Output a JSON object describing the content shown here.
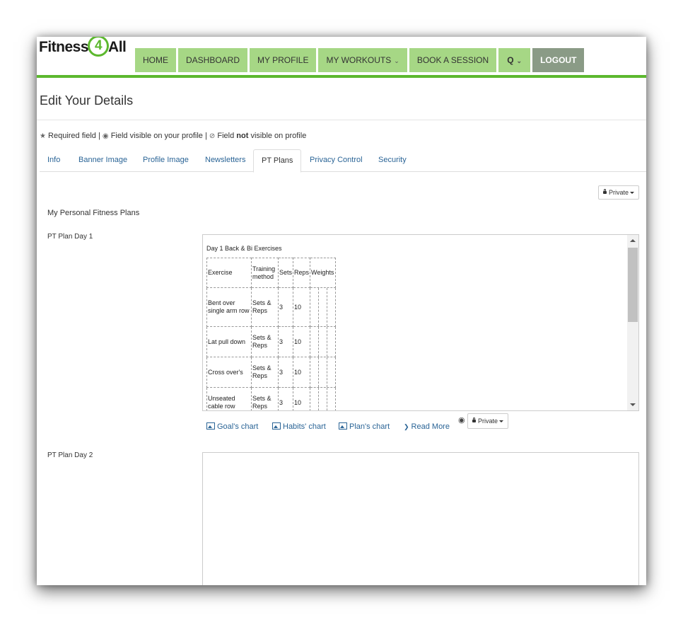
{
  "brand": {
    "logo_pre": "Fitness",
    "logo_num": "4",
    "logo_post": "All",
    "accent_color": "#5cb82e",
    "nav_color": "#a6d785"
  },
  "nav": {
    "items": [
      {
        "label": "HOME"
      },
      {
        "label": "DASHBOARD"
      },
      {
        "label": "MY PROFILE"
      },
      {
        "label": "MY WORKOUTS"
      },
      {
        "label": "BOOK A SESSION"
      },
      {
        "label": "LOGOUT"
      }
    ],
    "workouts_chevron": "⌄",
    "search_icon": "search-icon",
    "search_glyph": "Q",
    "search_chevron": "⌄"
  },
  "page": {
    "title": "Edit Your Details",
    "legend_required": "Required field",
    "legend_sep1": "|",
    "legend_visible": "Field visible on your profile",
    "legend_sep2": "|",
    "legend_field": "Field",
    "legend_not": "not",
    "legend_notvisible": "visible on profile"
  },
  "tabs": [
    {
      "label": "Info"
    },
    {
      "label": "Banner Image"
    },
    {
      "label": "Profile Image"
    },
    {
      "label": "Newsletters"
    },
    {
      "label": "PT Plans",
      "active": true
    },
    {
      "label": "Privacy Control"
    },
    {
      "label": "Security"
    }
  ],
  "privacy": {
    "top_label": "Private",
    "day1_label": "Private"
  },
  "section": {
    "title": "My Personal Fitness Plans",
    "day1_label": "PT Plan Day 1",
    "day2_label": "PT Plan Day 2"
  },
  "plan_day1": {
    "heading": "Day 1 Back & Bi Exercises",
    "headers": [
      "Exercise",
      "Training method",
      "Sets",
      "Reps",
      "Weights"
    ],
    "rows": [
      [
        "Bent over single arm row",
        "Sets & Reps",
        "3",
        "10"
      ],
      [
        "Lat pull down",
        "Sets & Reps",
        "3",
        "10"
      ],
      [
        "Cross over's",
        "Sets & Reps",
        "3",
        "10"
      ],
      [
        "Unseated cable row",
        "Sets & Reps",
        "3",
        "10"
      ]
    ]
  },
  "links": {
    "goals_chart": "Goal's chart",
    "habits_chart": "Habits' chart",
    "plans_chart": "Plan's chart",
    "read_more": "Read More"
  }
}
